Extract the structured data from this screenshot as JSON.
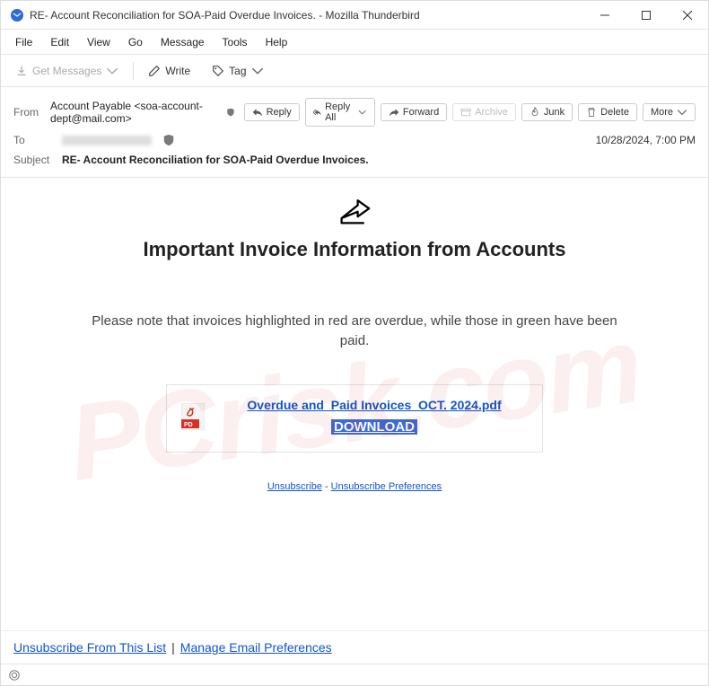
{
  "window": {
    "title": "RE- Account Reconciliation for SOA-Paid Overdue Invoices. - Mozilla Thunderbird"
  },
  "menu": {
    "file": "File",
    "edit": "Edit",
    "view": "View",
    "go": "Go",
    "message": "Message",
    "tools": "Tools",
    "help": "Help"
  },
  "toolbar": {
    "getmsgs": "Get Messages",
    "write": "Write",
    "tag": "Tag"
  },
  "hdr": {
    "from_label": "From",
    "from": "Account Payable <soa-account-dept@mail.com>",
    "to_label": "To",
    "subject_label": "Subject",
    "subject": "RE- Account Reconciliation for SOA-Paid Overdue Invoices.",
    "date": "10/28/2024, 7:00 PM"
  },
  "actions": {
    "reply": "Reply",
    "replyall": "Reply All",
    "forward": "Forward",
    "archive": "Archive",
    "junk": "Junk",
    "delete": "Delete",
    "more": "More"
  },
  "body": {
    "title": "Important Invoice Information from Accounts",
    "para": "Please note that invoices highlighted in red are overdue, while those in green have been paid.",
    "filename": "Overdue and_Paid Invoices_OCT. 2024.pdf",
    "download": "DOWNLOAD",
    "unsub": "Unsubscribe",
    "unsub_pref": "Unsubscribe Preferences"
  },
  "footer": {
    "unsub": "Unsubscribe From This List",
    "manage": "Manage Email Preferences"
  },
  "watermark": "PCrisk.com"
}
